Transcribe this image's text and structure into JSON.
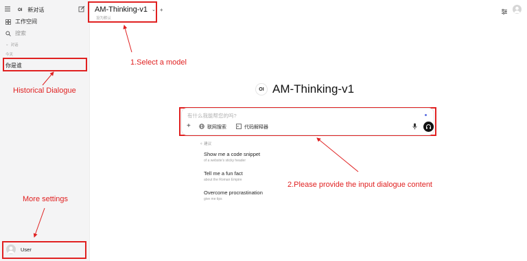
{
  "sidebar": {
    "new_chat_label": "新对话",
    "logo_text": "OI",
    "workspace_label": "工作空间",
    "search_label": "搜索",
    "section_label": "对话",
    "today_label": "今天",
    "chat_item": "你是谁",
    "user_name": "User"
  },
  "header": {
    "model_name": "AM-Thinking-v1",
    "set_default": "设为默认"
  },
  "hero": {
    "logo_text": "OI",
    "model_name": "AM-Thinking-v1"
  },
  "input": {
    "placeholder": "有什么我能帮您的吗?",
    "web_search_label": "联网搜索",
    "code_interpreter_label": "代码解释器"
  },
  "suggestions": {
    "header": "建议",
    "items": [
      {
        "title": "Show me a code snippet",
        "subtitle": "of a website's sticky header"
      },
      {
        "title": "Tell me a fun fact",
        "subtitle": "about the Roman Empire"
      },
      {
        "title": "Overcome procrastination",
        "subtitle": "give me tips"
      }
    ]
  },
  "annotations": {
    "select_model": "1.Select a model",
    "historical": "Historical Dialogue",
    "more_settings": "More settings",
    "provide_input": "2.Please provide the input dialogue content"
  },
  "colors": {
    "annotation_red": "#e02020",
    "sidebar_bg": "#f4f4f5"
  }
}
